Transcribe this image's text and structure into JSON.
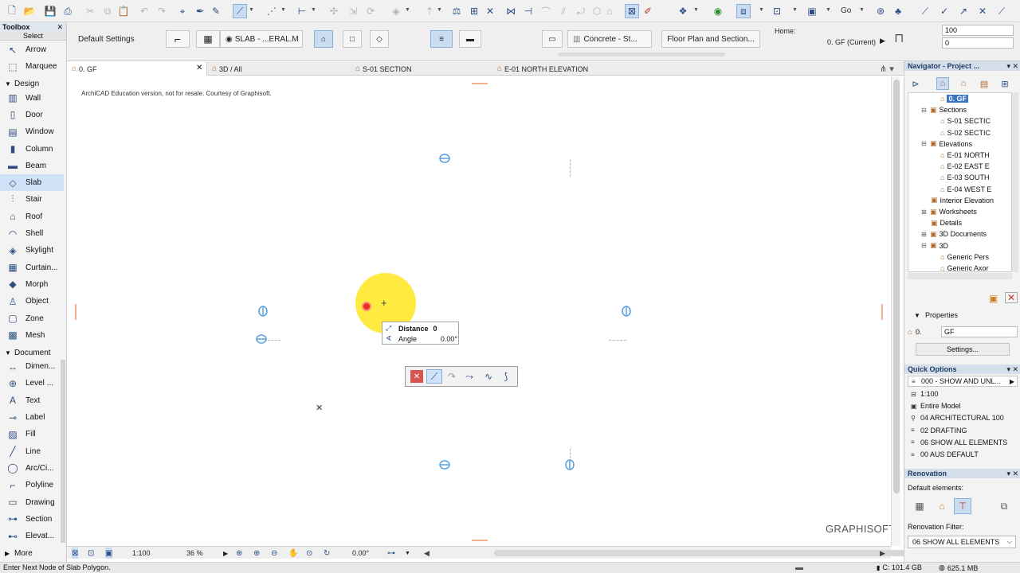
{
  "top_toolbar": {
    "go_label": "Go",
    "icons": [
      "new-icon",
      "open-icon",
      "save-icon",
      "print-icon",
      "cut-icon",
      "copy-icon",
      "paste-icon",
      "undo-icon",
      "redo-icon",
      "find-icon",
      "eyedropper-icon",
      "syringe-icon",
      "arrow-tool-icon",
      "magic-wand-icon",
      "marquee-icon",
      "gravity-icon",
      "snap-icon",
      "drag-icon",
      "rotate-icon",
      "mirror-icon",
      "elevate-icon",
      "grid-icon",
      "delete-icon",
      "trim-icon",
      "split-icon",
      "adjust-icon",
      "fillet-icon",
      "offset-icon",
      "layer-icon",
      "pen-icon",
      "layers-icon",
      "target-icon",
      "view-icon",
      "window-icon",
      "floor-icon",
      "navigate-icon",
      "walk-icon",
      "zoom-icon",
      "pencil-icon",
      "check-icon",
      "measure-icon",
      "tape-icon",
      "edit-icon"
    ]
  },
  "info_box": {
    "title": "Default Settings",
    "structure_label": "SLAB - ...ERAL.M",
    "material_label": "Concrete - St...",
    "view_label": "Floor Plan and Section...",
    "home_label": "Home:",
    "story_label": "0. GF (Current)",
    "value_top": "100",
    "value_offset": "0"
  },
  "toolbox": {
    "title": "Toolbox",
    "select_label": "Select",
    "tools": [
      {
        "label": "Arrow",
        "icon": "arrow-icon",
        "active": false
      },
      {
        "label": "Marquee",
        "icon": "marquee-icon",
        "active": false
      },
      {
        "label": "Design",
        "group": true
      },
      {
        "label": "Wall",
        "icon": "wall-icon",
        "active": false
      },
      {
        "label": "Door",
        "icon": "door-icon",
        "active": false
      },
      {
        "label": "Window",
        "icon": "window-icon",
        "active": false
      },
      {
        "label": "Column",
        "icon": "column-icon",
        "active": false
      },
      {
        "label": "Beam",
        "icon": "beam-icon",
        "active": false
      },
      {
        "label": "Slab",
        "icon": "slab-icon",
        "active": true
      },
      {
        "label": "Stair",
        "icon": "stair-icon",
        "active": false
      },
      {
        "label": "Roof",
        "icon": "roof-icon",
        "active": false
      },
      {
        "label": "Shell",
        "icon": "shell-icon",
        "active": false
      },
      {
        "label": "Skylight",
        "icon": "skylight-icon",
        "active": false
      },
      {
        "label": "Curtain...",
        "icon": "curtain-wall-icon",
        "active": false
      },
      {
        "label": "Morph",
        "icon": "morph-icon",
        "active": false
      },
      {
        "label": "Object",
        "icon": "object-icon",
        "active": false
      },
      {
        "label": "Zone",
        "icon": "zone-icon",
        "active": false
      },
      {
        "label": "Mesh",
        "icon": "mesh-icon",
        "active": false
      },
      {
        "label": "Document",
        "group": true
      },
      {
        "label": "Dimen...",
        "icon": "dimension-icon",
        "active": false
      },
      {
        "label": "Level ...",
        "icon": "level-icon",
        "active": false
      },
      {
        "label": "Text",
        "icon": "text-icon",
        "active": false
      },
      {
        "label": "Label",
        "icon": "label-icon",
        "active": false
      },
      {
        "label": "Fill",
        "icon": "fill-icon",
        "active": false
      },
      {
        "label": "Line",
        "icon": "line-icon",
        "active": false
      },
      {
        "label": "Arc/Ci...",
        "icon": "arc-icon",
        "active": false
      },
      {
        "label": "Polyline",
        "icon": "polyline-icon",
        "active": false
      },
      {
        "label": "Drawing",
        "icon": "drawing-icon",
        "active": false
      },
      {
        "label": "Section",
        "icon": "section-icon",
        "active": false
      },
      {
        "label": "Elevat...",
        "icon": "elevation-icon",
        "active": false
      },
      {
        "label": "More",
        "group": true
      }
    ]
  },
  "tabs": [
    {
      "label": "0. GF",
      "active": true
    },
    {
      "label": "3D / All",
      "active": false
    },
    {
      "label": "S-01 SECTION",
      "active": false
    },
    {
      "label": "E-01 NORTH ELEVATION",
      "active": false
    }
  ],
  "canvas": {
    "watermark": "ArchiCAD Education version, not for resale. Courtesy of Graphisoft.",
    "brand": "GRAPHISOFT."
  },
  "tracker": {
    "distance_label": "Distance",
    "distance_value": "0",
    "angle_label": "Angle",
    "angle_value": "0.00°"
  },
  "bottom_bar": {
    "scale": "1:100",
    "zoom": "36 %",
    "angle": "0.00°"
  },
  "status_bar": {
    "message": "Enter Next Node of Slab Polygon.",
    "disk": "C: 101.4 GB",
    "memory": "625.1 MB"
  },
  "navigator": {
    "title": "Navigator - Project ...",
    "items": [
      {
        "label": "0. GF",
        "level": 3,
        "selected": true,
        "exp": ""
      },
      {
        "label": "Sections",
        "level": 1,
        "exp": "−"
      },
      {
        "label": "S-01 SECTIC",
        "level": 3,
        "exp": ""
      },
      {
        "label": "S-02 SECTIC",
        "level": 3,
        "exp": ""
      },
      {
        "label": "Elevations",
        "level": 1,
        "exp": "−"
      },
      {
        "label": "E-01 NORTH",
        "level": 3,
        "exp": ""
      },
      {
        "label": "E-02 EAST E",
        "level": 3,
        "exp": ""
      },
      {
        "label": "E-03 SOUTH",
        "level": 3,
        "exp": ""
      },
      {
        "label": "E-04 WEST E",
        "level": 3,
        "exp": ""
      },
      {
        "label": "Interior Elevation",
        "level": 2,
        "exp": ""
      },
      {
        "label": "Worksheets",
        "level": 1,
        "exp": "+"
      },
      {
        "label": "Details",
        "level": 2,
        "exp": ""
      },
      {
        "label": "3D Documents",
        "level": 1,
        "exp": "+"
      },
      {
        "label": "3D",
        "level": 1,
        "exp": "−"
      },
      {
        "label": "Generic Pers",
        "level": 3,
        "exp": ""
      },
      {
        "label": "Generic Axor",
        "level": 3,
        "exp": ""
      }
    ]
  },
  "properties": {
    "title": "Properties",
    "id_prefix": "0.",
    "id_value": "GF",
    "settings_label": "Settings..."
  },
  "quick_options": {
    "title": "Quick Options",
    "combo_label": "000 - SHOW AND UNL...",
    "rows": [
      "1:100",
      "Entire Model",
      "04 ARCHITECTURAL 100",
      "02 DRAFTING",
      "06 SHOW ALL ELEMENTS",
      "00 AUS DEFAULT"
    ]
  },
  "renovation": {
    "title": "Renovation",
    "default_label": "Default elements:",
    "filter_label": "Renovation Filter:",
    "filter_value": "06 SHOW ALL ELEMENTS"
  },
  "colors": {
    "accent": "#3a74c4",
    "node": "#5aa0e0",
    "halo": "#ffe936",
    "cursor": "#e53222"
  }
}
